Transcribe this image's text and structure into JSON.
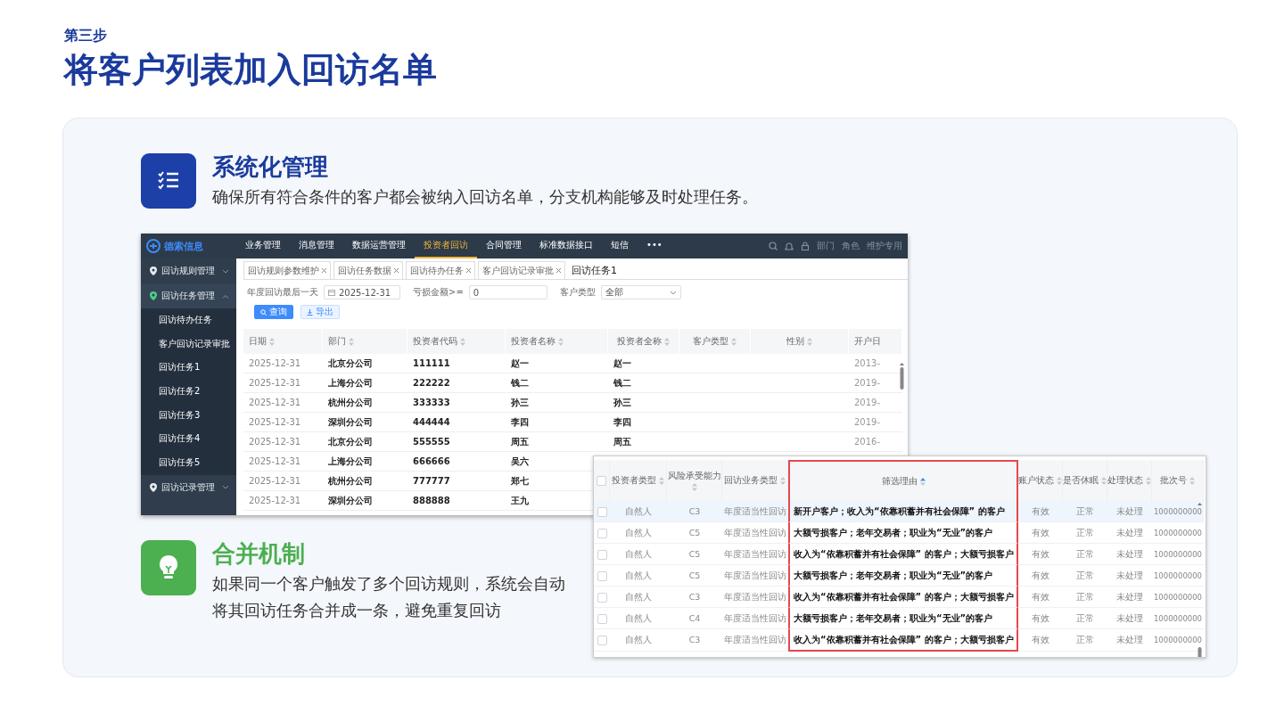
{
  "step": "第三步",
  "title": "将客户列表加入回访名单",
  "features": [
    {
      "kind": "checklist",
      "title": "系统化管理",
      "description": "确保所有符合条件的客户都会被纳入回访名单，分支机构能够及时处理任务。"
    },
    {
      "kind": "bulb",
      "title": "合并机制",
      "description": "如果同一个客户触发了多个回访规则，系统会自动将其回访任务合并成一条，避免重复回访"
    }
  ],
  "app_window": {
    "logo": "德索信息",
    "nav": [
      {
        "label": "业务管理",
        "selected": false
      },
      {
        "label": "消息管理",
        "selected": false
      },
      {
        "label": "数据运营管理",
        "selected": false
      },
      {
        "label": "投资者回访",
        "selected": true
      },
      {
        "label": "合同管理",
        "selected": false
      },
      {
        "label": "标准数据接口",
        "selected": false
      },
      {
        "label": "短信",
        "selected": false
      },
      {
        "label": "•••",
        "selected": false
      }
    ],
    "header_links": [
      "部门",
      "角色",
      "维护专用"
    ],
    "sidebar": [
      {
        "label": "回访规则管理",
        "expanded": false
      },
      {
        "label": "回访任务管理",
        "expanded": true,
        "children": [
          {
            "label": "回访待办任务"
          },
          {
            "label": "客户回访记录审批"
          },
          {
            "label": "回访任务1"
          },
          {
            "label": "回访任务2"
          },
          {
            "label": "回访任务3"
          },
          {
            "label": "回访任务4"
          },
          {
            "label": "回访任务5"
          }
        ]
      },
      {
        "label": "回访记录管理",
        "expanded": false
      }
    ],
    "tabs": [
      {
        "label": "回访规则参数维护",
        "selected": false
      },
      {
        "label": "回访任务数据",
        "selected": false
      },
      {
        "label": "回访待办任务",
        "selected": false
      },
      {
        "label": "客户回访记录审批",
        "selected": false
      },
      {
        "label": "回访任务1",
        "selected": true
      }
    ],
    "filters": [
      {
        "kind": "date",
        "label": "年度回访最后一天",
        "value": "2025-12-31"
      },
      {
        "kind": "text",
        "label": "亏损金额>=",
        "value": "0"
      },
      {
        "kind": "select",
        "label": "客户类型",
        "value": "全部"
      }
    ],
    "buttons": [
      {
        "kind": "primary",
        "label": "查询"
      },
      {
        "kind": "secondary",
        "label": "导出"
      }
    ],
    "table": {
      "columns": [
        "日期",
        "部门",
        "投资者代码",
        "投资者名称",
        "投资者全称",
        "客户类型",
        "性别",
        "开户日"
      ],
      "rows": [
        {
          "cells": [
            "2025-12-31",
            "北京分公司",
            "111111",
            "赵一",
            "赵一",
            "",
            "",
            "2013-"
          ]
        },
        {
          "cells": [
            "2025-12-31",
            "上海分公司",
            "222222",
            "钱二",
            "钱二",
            "",
            "",
            "2019-"
          ]
        },
        {
          "cells": [
            "2025-12-31",
            "杭州分公司",
            "333333",
            "孙三",
            "孙三",
            "",
            "",
            "2019-"
          ]
        },
        {
          "cells": [
            "2025-12-31",
            "深圳分公司",
            "444444",
            "李四",
            "李四",
            "",
            "",
            "2019-"
          ]
        },
        {
          "cells": [
            "2025-12-31",
            "北京分公司",
            "555555",
            "周五",
            "周五",
            "",
            "",
            "2016-"
          ]
        },
        {
          "cells": [
            "2025-12-31",
            "上海分公司",
            "666666",
            "吴六"
          ]
        },
        {
          "cells": [
            "2025-12-31",
            "杭州分公司",
            "777777",
            "郑七"
          ]
        },
        {
          "cells": [
            "2025-12-31",
            "深圳分公司",
            "888888",
            "王九"
          ]
        }
      ]
    }
  },
  "result_table": {
    "select_all": false,
    "columns": [
      {
        "label": "投资者类型",
        "sorted": false,
        "highlighted": false
      },
      {
        "label": "风险承受能力",
        "sorted": false,
        "highlighted": false
      },
      {
        "label": "回访业务类型",
        "sorted": false,
        "highlighted": false
      },
      {
        "label": "筛选理由",
        "sorted": true,
        "highlighted": true
      },
      {
        "label": "账户状态",
        "sorted": false,
        "highlighted": false
      },
      {
        "label": "是否休眠",
        "sorted": false,
        "highlighted": false
      },
      {
        "label": "处理状态",
        "sorted": false,
        "highlighted": false
      },
      {
        "label": "批次号",
        "sorted": false,
        "highlighted": false
      }
    ],
    "rows": [
      {
        "selected": true,
        "checked": false,
        "cells": [
          "自然人",
          "C3",
          "年度适当性回访",
          "新开户客户；收入为“依靠积蓄并有社会保障” 的客户",
          "有效",
          "正常",
          "未处理",
          "1000000000"
        ]
      },
      {
        "selected": false,
        "checked": false,
        "cells": [
          "自然人",
          "C5",
          "年度适当性回访",
          "大额亏损客户；老年交易者；职业为“无业”的客户",
          "有效",
          "正常",
          "未处理",
          "1000000000"
        ]
      },
      {
        "selected": false,
        "checked": false,
        "cells": [
          "自然人",
          "C5",
          "年度适当性回访",
          "收入为“依靠积蓄并有社会保障” 的客户；大额亏损客户",
          "有效",
          "正常",
          "未处理",
          "1000000000"
        ]
      },
      {
        "selected": false,
        "checked": false,
        "cells": [
          "自然人",
          "C5",
          "年度适当性回访",
          "大额亏损客户；老年交易者；职业为“无业”的客户",
          "有效",
          "正常",
          "未处理",
          "1000000000"
        ]
      },
      {
        "selected": false,
        "checked": false,
        "cells": [
          "自然人",
          "C3",
          "年度适当性回访",
          "收入为“依靠积蓄并有社会保障” 的客户；大额亏损客户",
          "有效",
          "正常",
          "未处理",
          "1000000000"
        ]
      },
      {
        "selected": false,
        "checked": false,
        "cells": [
          "自然人",
          "C4",
          "年度适当性回访",
          "大额亏损客户；老年交易者；职业为“无业”的客户",
          "有效",
          "正常",
          "未处理",
          "1000000000"
        ]
      },
      {
        "selected": false,
        "checked": false,
        "cells": [
          "自然人",
          "C3",
          "年度适当性回访",
          "收入为“依靠积蓄并有社会保障” 的客户；大额亏损客户",
          "有效",
          "正常",
          "未处理",
          "1000000000"
        ]
      }
    ]
  }
}
